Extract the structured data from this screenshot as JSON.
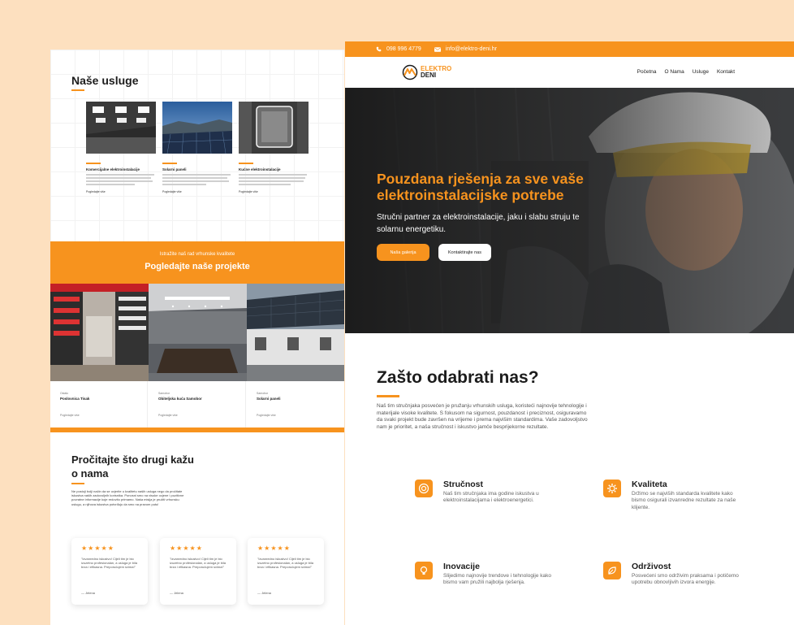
{
  "left_page": {
    "services": {
      "title": "Naše usluge",
      "items": [
        {
          "name": "Komercijalne elektroinstalacije",
          "link": "Pogledajte više"
        },
        {
          "name": "Solarni paneli",
          "link": "Pogledajte više"
        },
        {
          "name": "Kućne elektroinstalacije",
          "link": "Pogledajte više"
        }
      ]
    },
    "projects": {
      "subtitle": "Istražite naš rad vrhunske kvalitete",
      "title": "Pogledajte naše projekte",
      "items": [
        {
          "category": "Ostalo",
          "name": "Poslovnica Tisak",
          "link": "Pogledajte više"
        },
        {
          "category": "Samobor",
          "name": "Obiteljska kuća Samobor",
          "link": "Pogledajte više"
        },
        {
          "category": "Samobor",
          "name": "Solarni paneli",
          "link": "Pogledajte više"
        }
      ]
    },
    "testimonials": {
      "title": "Pročitajte što drugi kažu o nama",
      "text": "Ne postoji bolji način da se uvjerite u kvalitetu naših usluga nego da pročitate iskustva naših zadovoljnih korisnika. Ponosni smo na visoke ocjene i pozitivne povratne informacije koje redovito primamo. Naša misija je pružiti vrhunsku uslugu, a njihova iskustva potvrđuju da smo na pravom putu!",
      "stars": "★★★★★",
      "cards": [
        {
          "quote": "\"Izvanredno iskustvo! Cijeli tim je bio izuzetno profesionalan, a usluga je bila brza i efikasna. Preporučujem svima!\"",
          "author": "— Jelena"
        },
        {
          "quote": "\"Izvanredno iskustvo! Cijeli tim je bio izuzetno profesionalan, a usluga je bila brza i efikasna. Preporučujem svima!\"",
          "author": "— Jelena"
        },
        {
          "quote": "\"Izvanredno iskustvo! Cijeli tim je bio izuzetno profesionalan, a usluga je bila brza i efikasna. Preporučujem svima!\"",
          "author": "— Jelena"
        }
      ]
    }
  },
  "right_page": {
    "topbar": {
      "phone": "098 996 4779",
      "email": "info@elektro-deni.hr"
    },
    "logo": {
      "line1": "ELEKTRO",
      "line2": "DENI"
    },
    "nav": [
      "Početna",
      "O Nama",
      "Usluge",
      "Kontakt"
    ],
    "hero": {
      "title": "Pouzdana rješenja za sve vaše elektroinstalacijske potrebe",
      "subtitle": "Stručni partner za elektroinstalacije, jaku i slabu struju te solarnu energetiku.",
      "primary_button": "Naša galerija",
      "secondary_button": "Kontaktirajte nas"
    },
    "why": {
      "title": "Zašto odabrati nas?",
      "text": "Naš tim stručnjaka posvećen je pružanju vrhunskih usluga, koristeći najnovije tehnologije i materijale visoke kvalitete. S fokusom na sigurnost, pouzdanost i preciznost, osiguravamo da svaki projekt bude završen na vrijeme i prema najvišim standardima. Vaše zadovoljstvo nam je prioritet, a naša stručnost i iskustvo jamče besprijekorne rezultate.",
      "features": [
        {
          "title": "Stručnost",
          "text": "Naš tim stručnjaka ima godine iskustva u elektroinstalacijama i elektroenergetici.",
          "icon": "badge-icon"
        },
        {
          "title": "Kvaliteta",
          "text": "Držimo se najviših standarda kvalitete kako bismo osigurali izvanredne rezultate za naše klijente.",
          "icon": "gear-icon"
        },
        {
          "title": "Inovacije",
          "text": "Slijedimo najnovije trendove i tehnologije kako bismo vam pružili najbolja rješenja.",
          "icon": "lightbulb-icon"
        },
        {
          "title": "Održivost",
          "text": "Posvećeni smo održivim praksama i potičemo upotrebu obnovljivih izvora energije.",
          "icon": "leaf-icon"
        }
      ]
    }
  },
  "colors": {
    "accent": "#f7931e",
    "background": "#fde0bf",
    "text": "#1c1c1c"
  }
}
